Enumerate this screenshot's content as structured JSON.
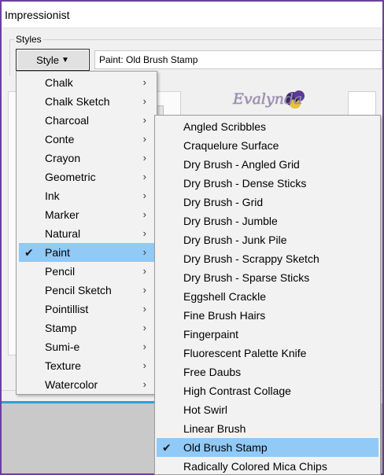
{
  "window": {
    "title": "Impressionist"
  },
  "styles": {
    "group_label": "Styles",
    "style_button_label": "Style",
    "preset_value": "Paint: Old Brush Stamp"
  },
  "watermark": {
    "text": "Evalynda"
  },
  "style_menu": {
    "items": [
      {
        "label": "Chalk",
        "has_submenu": true,
        "selected": false
      },
      {
        "label": "Chalk Sketch",
        "has_submenu": true,
        "selected": false
      },
      {
        "label": "Charcoal",
        "has_submenu": true,
        "selected": false
      },
      {
        "label": "Conte",
        "has_submenu": true,
        "selected": false
      },
      {
        "label": "Crayon",
        "has_submenu": true,
        "selected": false
      },
      {
        "label": "Geometric",
        "has_submenu": true,
        "selected": false
      },
      {
        "label": "Ink",
        "has_submenu": true,
        "selected": false
      },
      {
        "label": "Marker",
        "has_submenu": true,
        "selected": false
      },
      {
        "label": "Natural",
        "has_submenu": true,
        "selected": false
      },
      {
        "label": "Paint",
        "has_submenu": true,
        "selected": true
      },
      {
        "label": "Pencil",
        "has_submenu": true,
        "selected": false
      },
      {
        "label": "Pencil Sketch",
        "has_submenu": true,
        "selected": false
      },
      {
        "label": "Pointillist",
        "has_submenu": true,
        "selected": false
      },
      {
        "label": "Stamp",
        "has_submenu": true,
        "selected": false
      },
      {
        "label": "Sumi-e",
        "has_submenu": true,
        "selected": false
      },
      {
        "label": "Texture",
        "has_submenu": true,
        "selected": false
      },
      {
        "label": "Watercolor",
        "has_submenu": true,
        "selected": false
      }
    ]
  },
  "paint_submenu": {
    "items": [
      {
        "label": "Angled Scribbles",
        "selected": false
      },
      {
        "label": "Craquelure Surface",
        "selected": false
      },
      {
        "label": "Dry Brush - Angled Grid",
        "selected": false
      },
      {
        "label": "Dry Brush - Dense Sticks",
        "selected": false
      },
      {
        "label": "Dry Brush - Grid",
        "selected": false
      },
      {
        "label": "Dry Brush - Jumble",
        "selected": false
      },
      {
        "label": "Dry Brush - Junk Pile",
        "selected": false
      },
      {
        "label": "Dry Brush - Scrappy Sketch",
        "selected": false
      },
      {
        "label": "Dry Brush - Sparse Sticks",
        "selected": false
      },
      {
        "label": "Eggshell Crackle",
        "selected": false
      },
      {
        "label": "Fine Brush Hairs",
        "selected": false
      },
      {
        "label": "Fingerpaint",
        "selected": false
      },
      {
        "label": "Fluorescent Palette Knife",
        "selected": false
      },
      {
        "label": "Free Daubs",
        "selected": false
      },
      {
        "label": "High Contrast Collage",
        "selected": false
      },
      {
        "label": "Hot Swirl",
        "selected": false
      },
      {
        "label": "Linear Brush",
        "selected": false
      },
      {
        "label": "Old Brush Stamp",
        "selected": true
      },
      {
        "label": "Radically Colored Mica Chips",
        "selected": false
      }
    ]
  },
  "icons": {
    "submenu_arrow": "chevron-right-icon",
    "checkmark": "check-icon",
    "dropdown_caret": "caret-down-icon"
  },
  "colors": {
    "frame": "#6b3f9e",
    "selected_item": "#91c9f7",
    "menu_background": "#f2f2f2"
  }
}
